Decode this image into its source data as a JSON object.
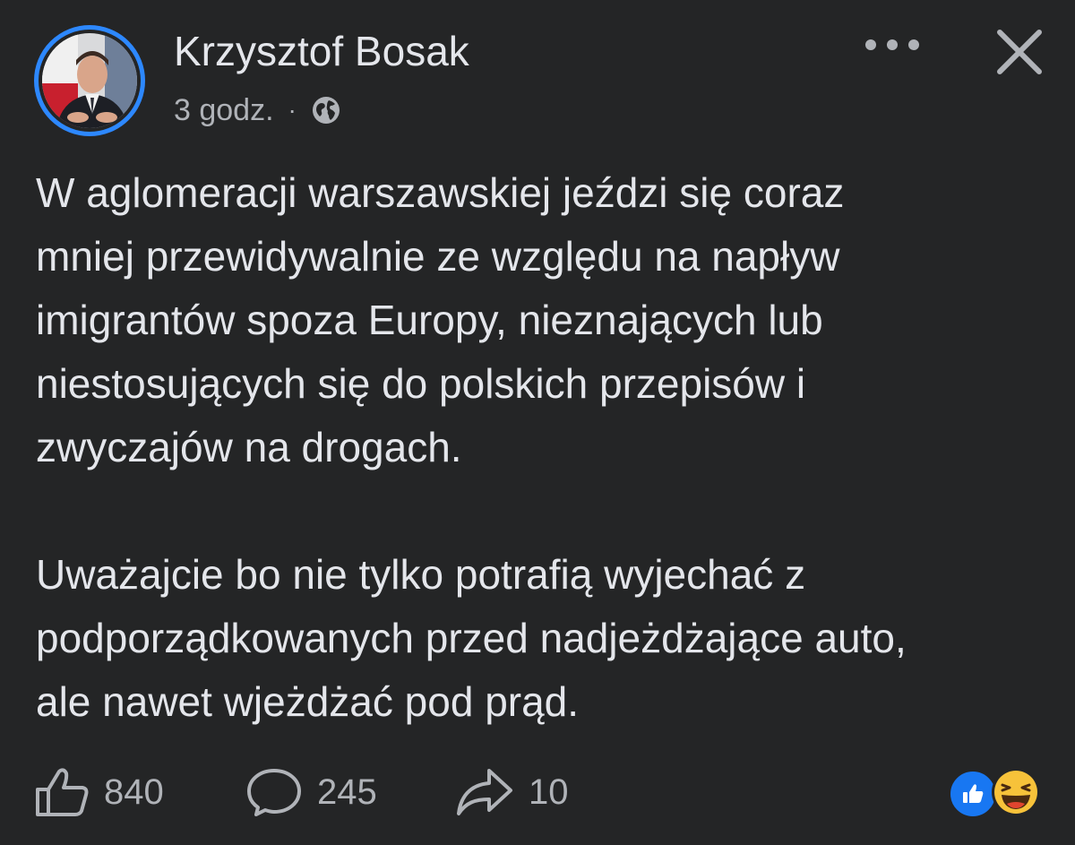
{
  "post": {
    "author": "Krzysztof Bosak",
    "timestamp": "3 godz.",
    "separator": "·",
    "audience_icon": "globe-icon",
    "paragraphs": [
      "W aglomeracji warszawskiej jeździ się coraz\nmniej przewidywalnie ze względu na napływ\nimigrantów spoza Europy, nieznających lub\nniestosujących się do polskich przepisów i\nzwyczajów na drogach.",
      "Uważajcie bo nie tylko potrafią wyjechać z\npodporządkowanych przed nadjeżdżające auto,\nale nawet wjeżdżać pod prąd."
    ]
  },
  "actions": {
    "like_count": "840",
    "comment_count": "245",
    "share_count": "10"
  },
  "reactions": [
    "like-reaction-icon",
    "haha-reaction-icon"
  ],
  "colors": {
    "background": "#242526",
    "primary_text": "#e4e6eb",
    "secondary_text": "#b0b3b8",
    "accent": "#2d88ff",
    "like_blue": "#1877f2",
    "haha_yellow": "#f7c23a"
  }
}
